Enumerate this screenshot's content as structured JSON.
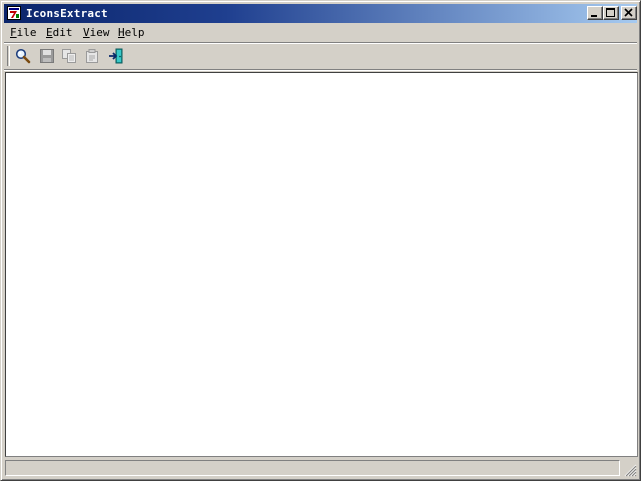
{
  "window": {
    "title": "IconsExtract"
  },
  "titlebar_buttons": [
    {
      "name": "minimize-button",
      "icon": "minimize-icon"
    },
    {
      "name": "maximize-button",
      "icon": "maximize-icon"
    },
    {
      "name": "close-button",
      "icon": "close-icon"
    }
  ],
  "menu": {
    "file": {
      "accel": "F",
      "rest": "ile"
    },
    "edit": {
      "accel": "E",
      "rest": "dit"
    },
    "view": {
      "accel": "V",
      "rest": "iew"
    },
    "help": {
      "accel": "H",
      "rest": "elp"
    }
  },
  "toolbar": [
    {
      "name": "search-icon",
      "enabled": true
    },
    {
      "name": "save-icon",
      "enabled": false
    },
    {
      "name": "copy-icon",
      "enabled": false
    },
    {
      "name": "properties-icon",
      "enabled": false
    },
    {
      "name": "exit-icon",
      "enabled": true
    }
  ],
  "status": {
    "text": ""
  },
  "colors": {
    "titlebar_start": "#0a246a",
    "titlebar_end": "#a6caf0",
    "face": "#d4d0c8"
  }
}
